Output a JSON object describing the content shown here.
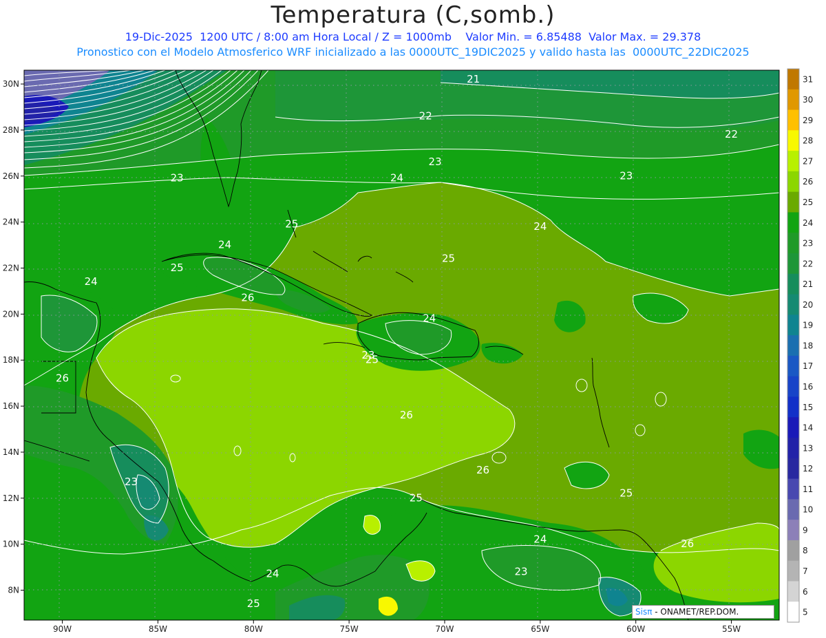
{
  "header": {
    "title": "Temperatura (C,somb.)",
    "subtitle_line1": "19-Dic-2025  1200 UTC / 8:00 am Hora Local / Z = 1000mb    Valor Min. = 6.85488  Valor Max. = 29.378",
    "subtitle_line2": "Pronostico con el Modelo Atmosferico WRF inicializado a las 0000UTC_19DIC2025 y valido hasta las  0000UTC_22DIC2025"
  },
  "map": {
    "lon_range": [
      -92,
      -52.5
    ],
    "lat_range": [
      6.7,
      30.6
    ],
    "lon_ticks": [
      "90W",
      "85W",
      "80W",
      "75W",
      "70W",
      "65W",
      "60W",
      "55W"
    ],
    "lat_ticks": [
      "30N",
      "28N",
      "26N",
      "24N",
      "22N",
      "20N",
      "18N",
      "16N",
      "14N",
      "12N",
      "10N",
      "8N"
    ],
    "grid": "dotted",
    "contour_labels": [
      {
        "text": "21",
        "lon": -68.5,
        "lat": 30.2
      },
      {
        "text": "22",
        "lon": -71.0,
        "lat": 28.6
      },
      {
        "text": "22",
        "lon": -55.0,
        "lat": 27.8
      },
      {
        "text": "23",
        "lon": -70.5,
        "lat": 26.6
      },
      {
        "text": "23",
        "lon": -84.0,
        "lat": 25.9
      },
      {
        "text": "23",
        "lon": -60.5,
        "lat": 26.0
      },
      {
        "text": "24",
        "lon": -72.5,
        "lat": 25.9
      },
      {
        "text": "24",
        "lon": -65.0,
        "lat": 23.8
      },
      {
        "text": "24",
        "lon": -81.5,
        "lat": 23.0
      },
      {
        "text": "24",
        "lon": -88.5,
        "lat": 21.4
      },
      {
        "text": "24",
        "lon": -70.8,
        "lat": 19.8
      },
      {
        "text": "25",
        "lon": -78.0,
        "lat": 23.9
      },
      {
        "text": "25",
        "lon": -84.0,
        "lat": 22.0
      },
      {
        "text": "25",
        "lon": -69.8,
        "lat": 22.4
      },
      {
        "text": "25",
        "lon": -73.8,
        "lat": 18.0
      },
      {
        "text": "25",
        "lon": -71.5,
        "lat": 12.0
      },
      {
        "text": "25",
        "lon": -60.5,
        "lat": 12.2
      },
      {
        "text": "25",
        "lon": -80.0,
        "lat": 7.4
      },
      {
        "text": "26",
        "lon": -80.3,
        "lat": 20.7
      },
      {
        "text": "26",
        "lon": -90.0,
        "lat": 17.2
      },
      {
        "text": "26",
        "lon": -72.0,
        "lat": 15.6
      },
      {
        "text": "26",
        "lon": -68.0,
        "lat": 13.2
      },
      {
        "text": "26",
        "lon": -57.3,
        "lat": 10.0
      },
      {
        "text": "23",
        "lon": -86.4,
        "lat": 12.7
      },
      {
        "text": "24",
        "lon": -79.0,
        "lat": 8.7
      },
      {
        "text": "24",
        "lon": -65.0,
        "lat": 10.2
      },
      {
        "text": "23",
        "lon": -66.0,
        "lat": 8.8
      },
      {
        "text": "23",
        "lon": -74.0,
        "lat": 18.2
      }
    ]
  },
  "colorbar": {
    "labels": [
      "31",
      "30",
      "29",
      "28",
      "27",
      "26",
      "25",
      "24",
      "23",
      "22",
      "21",
      "20",
      "19",
      "18",
      "17",
      "16",
      "15",
      "14",
      "13",
      "12",
      "11",
      "10",
      "9",
      "8",
      "7",
      "6",
      "5"
    ],
    "colors": [
      "#c07800",
      "#e09800",
      "#ffc000",
      "#f8f800",
      "#b8f000",
      "#8cd600",
      "#6aaa00",
      "#12a412",
      "#1f9a28",
      "#1e9638",
      "#168d5c",
      "#158a72",
      "#0f8490",
      "#1a6fb0",
      "#1a58c4",
      "#1844c8",
      "#1230c8",
      "#1a1ab8",
      "#2222a8",
      "#2828a0",
      "#4848b0",
      "#6a6ab0",
      "#8c80b8",
      "#a0a0a0",
      "#b4b4b4",
      "#d4d4d4",
      "#ffffff"
    ]
  },
  "credit": {
    "logo": "Sisπ",
    "org": " - ONAMET/REP.DOM."
  }
}
